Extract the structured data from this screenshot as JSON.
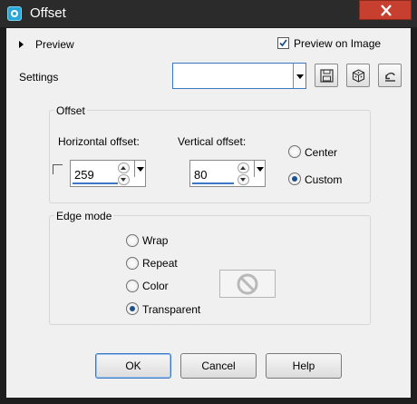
{
  "window": {
    "title": "Offset"
  },
  "preview": {
    "label": "Preview",
    "preview_on_image_label": "Preview on Image",
    "preview_on_image_checked": true
  },
  "settings": {
    "label": "Settings",
    "value": ""
  },
  "offset_group": {
    "title": "Offset",
    "horizontal_label": "Horizontal offset:",
    "horizontal_value": "259",
    "vertical_label": "Vertical offset:",
    "vertical_value": "80",
    "center_label": "Center",
    "custom_label": "Custom",
    "selected": "Custom"
  },
  "edge_group": {
    "title": "Edge mode",
    "options": [
      "Wrap",
      "Repeat",
      "Color",
      "Transparent"
    ],
    "selected": "Transparent"
  },
  "buttons": {
    "ok": "OK",
    "cancel": "Cancel",
    "help": "Help"
  },
  "icons": [
    "app-icon",
    "close-icon",
    "save-preset-icon",
    "randomize-icon",
    "reset-icon",
    "no-color-icon",
    "expand-arrow-icon"
  ],
  "colors": {
    "title_bar": "#2b2b2b",
    "close_button": "#c7402f",
    "dialog_bg": "#f0f0f0",
    "accent": "#3b79c7"
  }
}
